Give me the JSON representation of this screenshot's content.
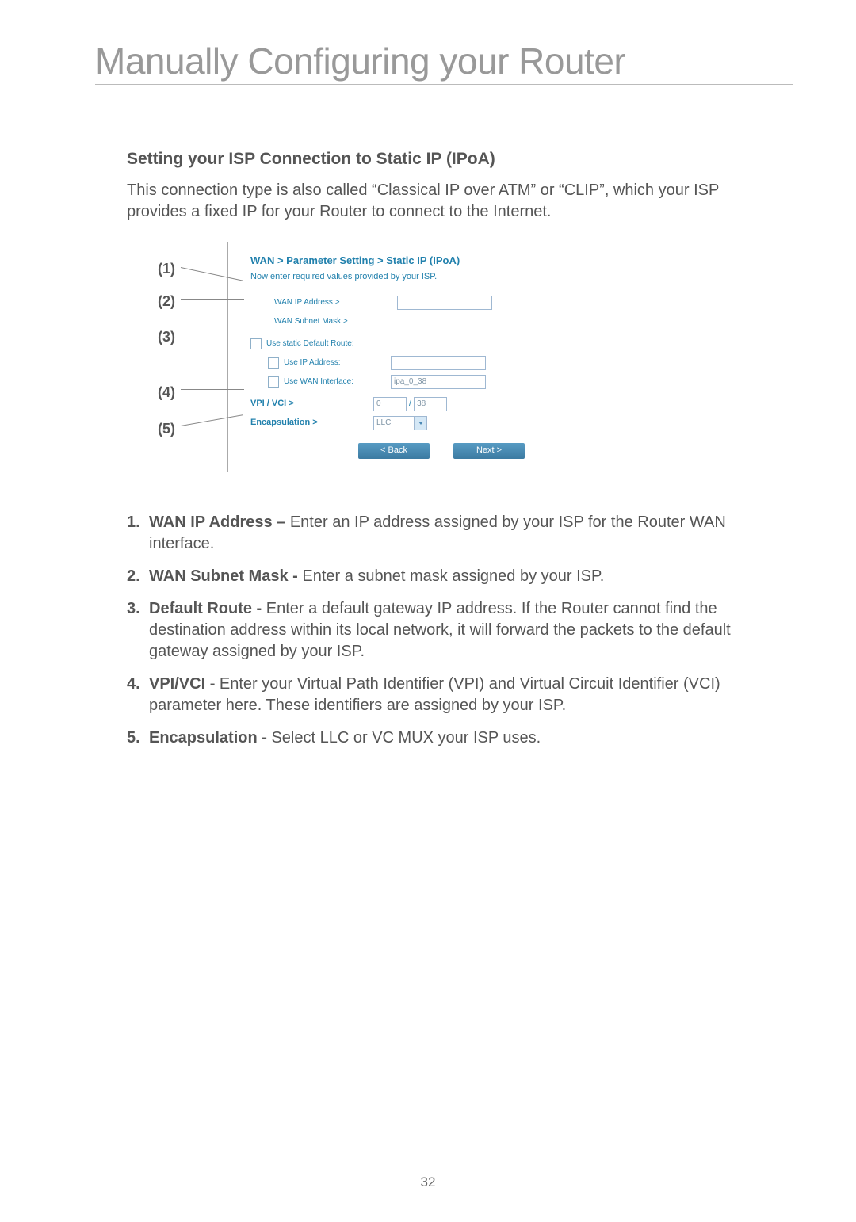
{
  "page": {
    "main_heading": "Manually Configuring your Router",
    "number": "32"
  },
  "section": {
    "title": "Setting your ISP Connection to Static IP (IPoA)",
    "text": "This connection type is also called “Classical IP over ATM” or “CLIP”, which your ISP provides a fixed IP for your Router to connect to the Internet."
  },
  "callouts": {
    "c1": "(1)",
    "c2": "(2)",
    "c3": "(3)",
    "c4": "(4)",
    "c5": "(5)"
  },
  "panel": {
    "breadcrumb": "WAN > Parameter Setting > Static IP (IPoA)",
    "desc": "Now enter required values provided by your ISP.",
    "labels": {
      "wan_ip": "WAN IP Address >",
      "subnet": "WAN Subnet Mask >",
      "static_route": "Use static Default Route:",
      "use_ip": "Use IP Address:",
      "use_wan_if": "Use WAN Interface:",
      "vpi_vci": "VPI / VCI >",
      "encap": "Encapsulation >"
    },
    "values": {
      "wan_if_value": "ipa_0_38",
      "vpi_value": "0",
      "vci_value": "38",
      "encap_value": "LLC"
    },
    "buttons": {
      "back": "< Back",
      "next": "Next >"
    }
  },
  "list": {
    "items": [
      {
        "num": "1.",
        "title": "WAN IP Address – ",
        "body": "Enter an IP address assigned by your ISP for the Router WAN interface."
      },
      {
        "num": "2.",
        "title": "WAN Subnet Mask - ",
        "body": "Enter a subnet mask assigned by your ISP."
      },
      {
        "num": "3.",
        "title": "Default Route - ",
        "body": "Enter a default gateway IP address. If the Router cannot find the destination address within its local network, it will forward the packets to the default gateway assigned by your ISP."
      },
      {
        "num": "4.",
        "title": "VPI/VCI - ",
        "body": "Enter your Virtual Path Identifier (VPI) and Virtual Circuit Identifier (VCI) parameter here. These identifiers are assigned by your ISP."
      },
      {
        "num": "5.",
        "title": "Encapsulation - ",
        "body": "Select LLC or VC MUX your ISP uses."
      }
    ]
  }
}
